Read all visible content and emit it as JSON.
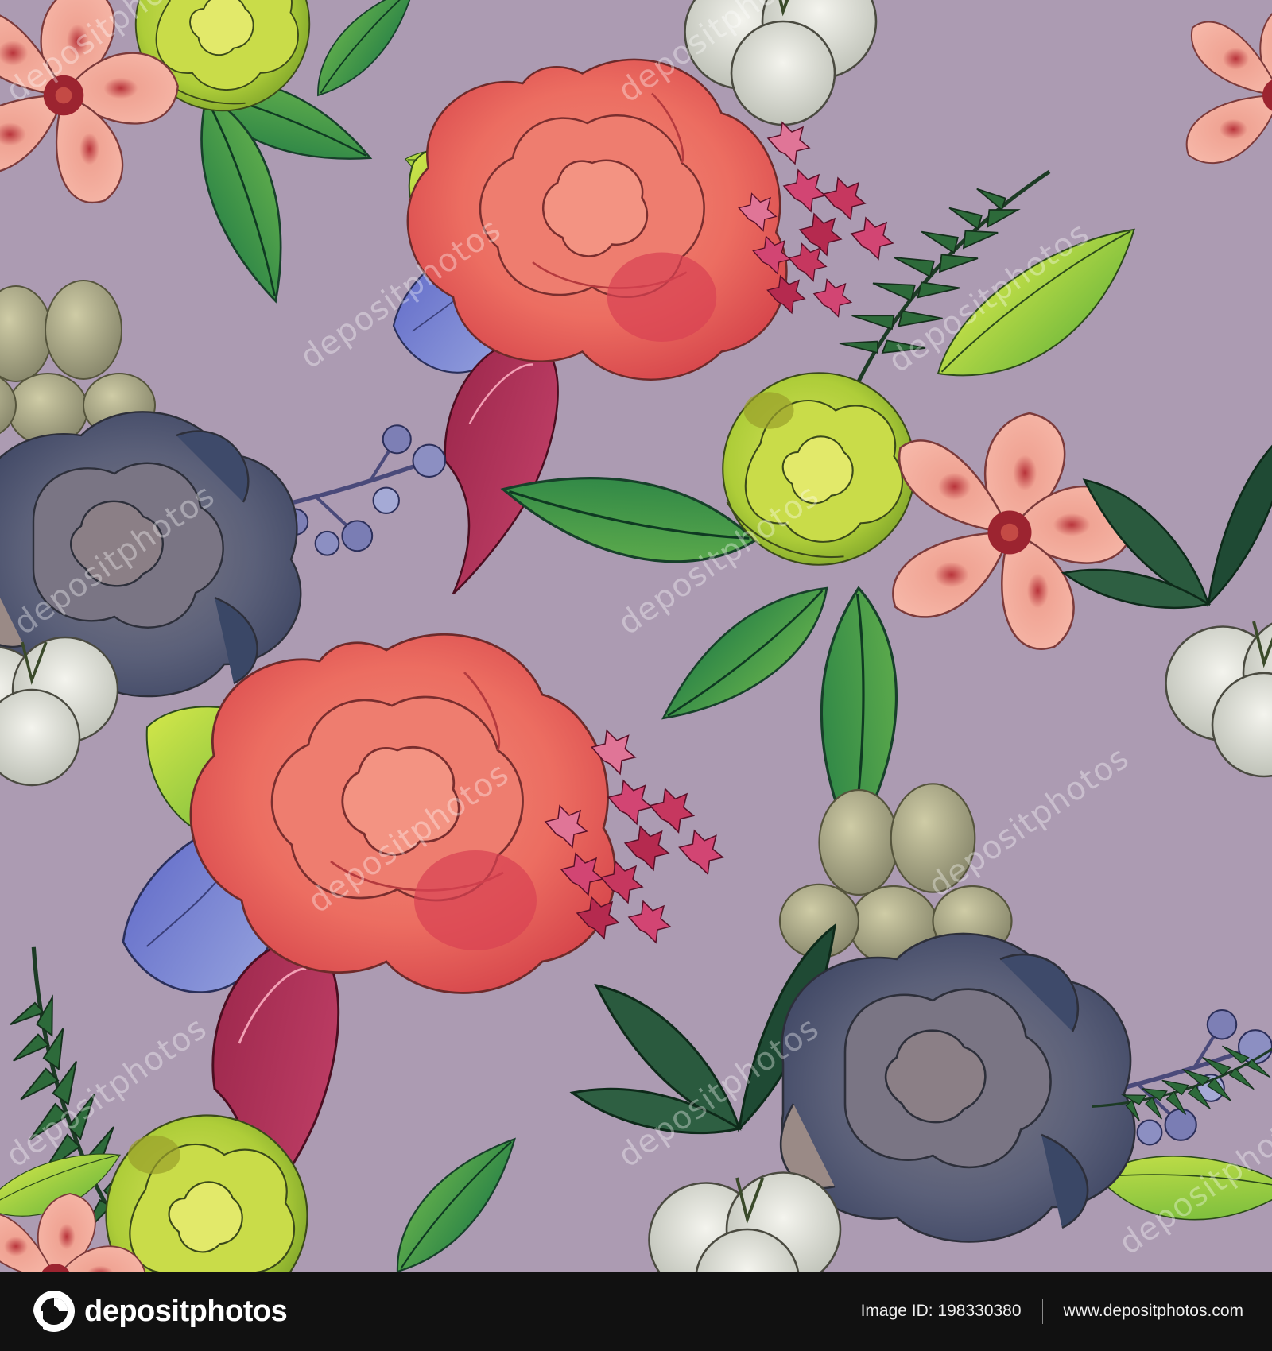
{
  "background_color": "#ac9bb2",
  "watermark": {
    "text": "depositphotos"
  },
  "footer": {
    "logo_text": "depositphotos",
    "image_id": "Image ID: 198330380",
    "site_url": "www.depositphotos.com",
    "logo_icon": "camera-shutter-icon",
    "background_color": "#111111"
  },
  "palette": {
    "rose": "#ef7b6e",
    "rose_dark": "#d9484c",
    "peach": "#f3a797",
    "leaf": "#3f9b4f",
    "lime": "#b7d33a",
    "succulent": "#5f6780",
    "cotton": "#e6e6e0",
    "calla": "#a9244a",
    "hydrangea": "#d0406d",
    "blue_petal": "#6a74c8"
  }
}
